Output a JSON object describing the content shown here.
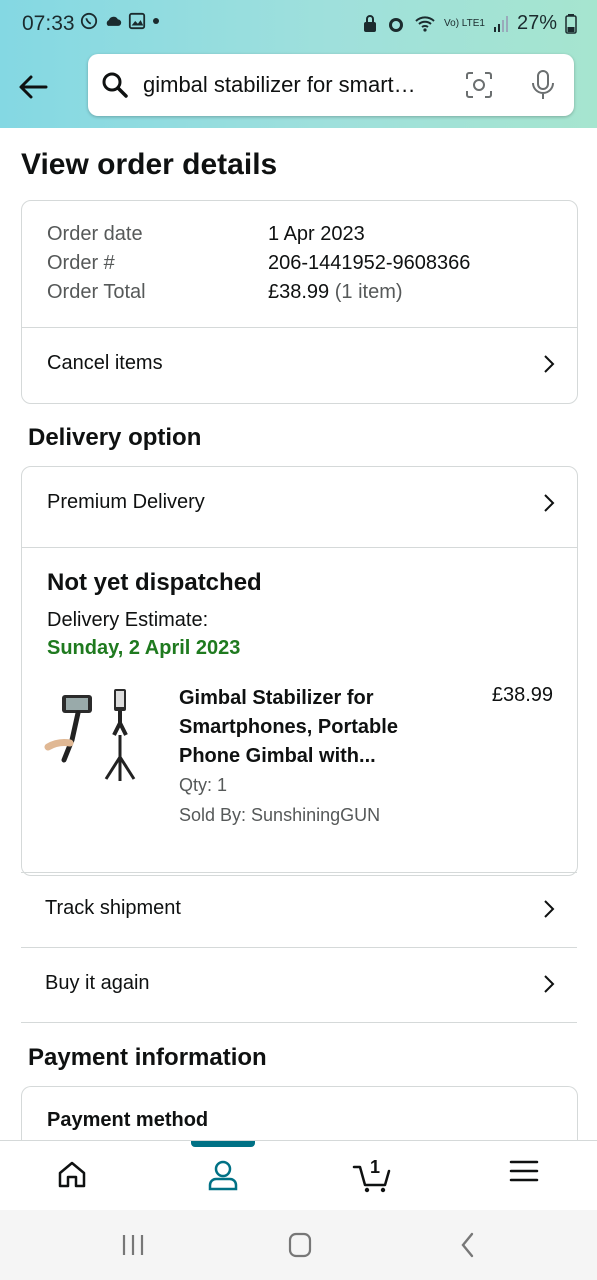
{
  "status_bar": {
    "time": "07:33",
    "battery": "27%",
    "network": "Vo) LTE1"
  },
  "header": {
    "search_query": "gimbal stabilizer for smart…",
    "icons": [
      "back-arrow-icon",
      "search-icon",
      "camera-scan-icon",
      "microphone-icon"
    ]
  },
  "page": {
    "title": "View order details"
  },
  "order_summary": {
    "order_date_label": "Order date",
    "order_date_value": "1 Apr 2023",
    "order_number_label": "Order #",
    "order_number_value": "206-1441952-9608366",
    "order_total_label": "Order Total",
    "order_total_value": "£38.99",
    "order_total_items": "(1 item)",
    "cancel_label": "Cancel items"
  },
  "delivery": {
    "section_title": "Delivery option",
    "option_label": "Premium Delivery",
    "status": "Not yet dispatched",
    "estimate_label": "Delivery Estimate:",
    "estimate_date": "Sunday, 2 April 2023",
    "estimate_color": "#1f7a1f"
  },
  "product": {
    "title": "Gimbal Stabilizer for Smartphones, Portable Phone Gimbal with...",
    "price": "£38.99",
    "qty": "Qty: 1",
    "sold_by": "Sold By: SunshiningGUN"
  },
  "actions": {
    "track_label": "Track shipment",
    "buy_again_label": "Buy it again"
  },
  "payment": {
    "section_title": "Payment information",
    "method_label": "Payment method"
  },
  "bottom_nav": {
    "cart_count": "1",
    "active_tab": "account",
    "accent": "#007185"
  }
}
